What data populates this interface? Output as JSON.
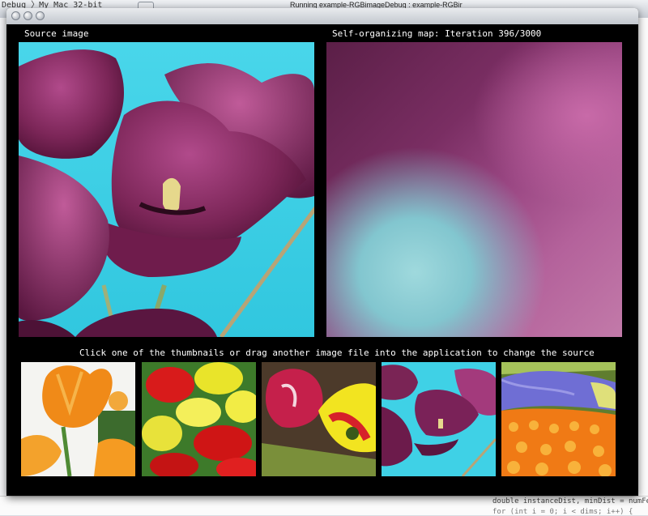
{
  "background": {
    "breadcrumb": "Debug 〉My Mac 32-bit",
    "activity": "Running example-RGBimageDebug : example-RGBir",
    "code_line": "double instanceDist, minDist = numFe",
    "code_line2": "for (int i = 0; i < dims; i++) {"
  },
  "window": {
    "source_label": "Source image",
    "som_label": "Self-organizing map: Iteration 396/3000",
    "instruction": "Click one of the thumbnails or drag another image file into the application to change the source"
  },
  "thumbnails": [
    {
      "subject": "orange-tulips"
    },
    {
      "subject": "red-yellow-tulips"
    },
    {
      "subject": "pink-yellow-tulips"
    },
    {
      "subject": "purple-tulips"
    },
    {
      "subject": "tulip-field"
    }
  ],
  "colors": {
    "window_bg": "#000000",
    "label_text": "#ffffff",
    "sky_cyan": "#3fd2e6",
    "tulip_purple": "#6e1f4f"
  }
}
